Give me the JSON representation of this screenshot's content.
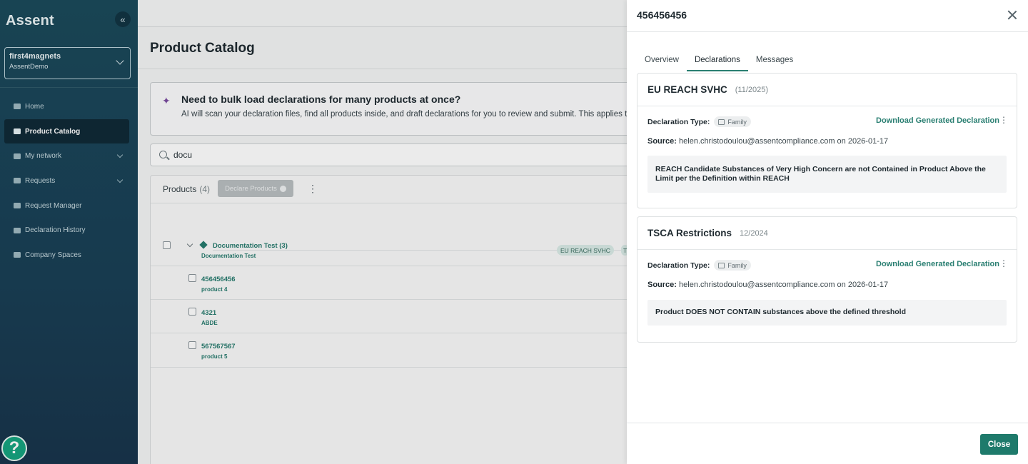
{
  "sidebar": {
    "logo": "Assent",
    "account": {
      "name": "first4magnets",
      "org": "AssentDemo"
    },
    "items": [
      {
        "label": "Home",
        "icon": "home-icon"
      },
      {
        "label": "Product Catalog",
        "icon": "box-icon",
        "active": true
      },
      {
        "label": "My network",
        "icon": "users-icon",
        "expandable": true
      },
      {
        "label": "Requests",
        "icon": "mail-icon",
        "expandable": true
      },
      {
        "label": "Request Manager",
        "icon": "inbox-icon"
      },
      {
        "label": "Declaration History",
        "icon": "document-icon"
      },
      {
        "label": "Company Spaces",
        "icon": "grid-icon"
      }
    ],
    "help_label": "?"
  },
  "main": {
    "title": "Product Catalog",
    "banner": {
      "heading": "Need to bulk load declarations for many products at once?",
      "text": "AI will scan your declaration files, find all products inside, and draft declarations for you to review and submit. This applies to"
    },
    "search": {
      "value": "docu"
    },
    "products": {
      "label": "Products",
      "count": "(4)",
      "declare_button": "Declare Products",
      "group": {
        "name": "Documentation Test (3)",
        "sub": "Documentation Test",
        "tag": "EU REACH SVHC",
        "tag2": "T"
      },
      "rows": [
        {
          "id": "456456456",
          "name": "product 4"
        },
        {
          "id": "4321",
          "name": "ABDE"
        },
        {
          "id": "567567567",
          "name": "product 5"
        }
      ]
    }
  },
  "drawer": {
    "title": "456456456",
    "tabs": [
      "Overview",
      "Declarations",
      "Messages"
    ],
    "active_tab": "Declarations",
    "declarations": [
      {
        "name": "EU REACH SVHC",
        "date": "(11/2025)",
        "type_label": "Declaration Type:",
        "type_value": "Family",
        "download_label": "Download Generated Declaration",
        "source_label": "Source:",
        "source_value": "helen.christodoulou@assentcompliance.com on 2026-01-17",
        "statement": "REACH Candidate Substances of Very High Concern are not Contained in Product Above the Limit per the Definition within REACH"
      },
      {
        "name": "TSCA Restrictions",
        "date": "12/2024",
        "type_label": "Declaration Type:",
        "type_value": "Family",
        "download_label": "Download Generated Declaration",
        "source_label": "Source:",
        "source_value": "helen.christodoulou@assentcompliance.com on 2026-01-17",
        "statement": "Product DOES NOT CONTAIN substances above the defined threshold"
      }
    ],
    "close_label": "Close"
  },
  "colors": {
    "accent": "#1e7a6b",
    "sidebar": "#1b4a5b",
    "link": "#2a7f72"
  }
}
